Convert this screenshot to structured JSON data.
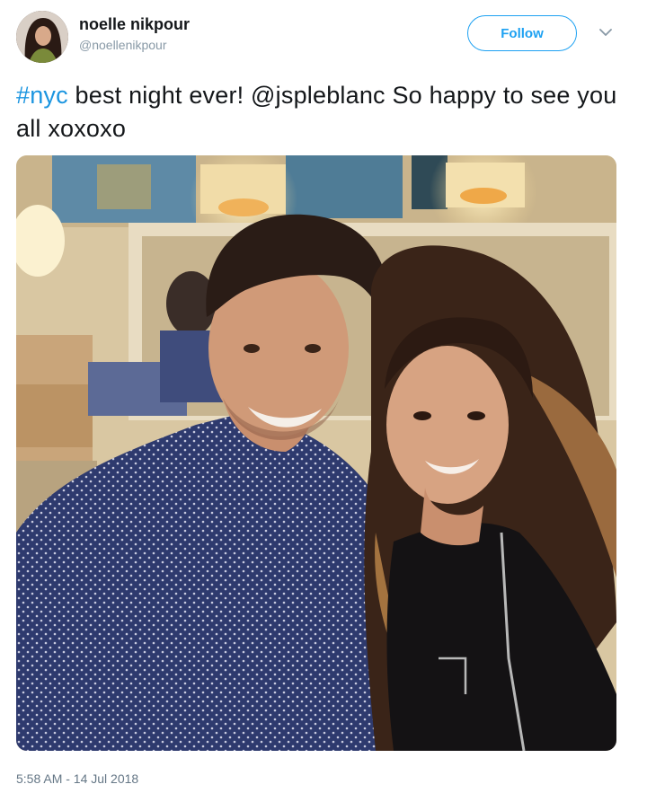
{
  "user": {
    "display_name": "noelle nikpour",
    "handle": "@noellenikpour"
  },
  "follow_label": "Follow",
  "tweet": {
    "hashtag": "#nyc",
    "text": " best night ever! @jspleblanc So happy to see you all xoxoxo",
    "timestamp": "5:58 AM - 14 Jul 2018"
  },
  "icons": {
    "caret": "chevron-down-icon"
  },
  "colors": {
    "accent": "#1da1f2",
    "hashtag": "#1b95e0",
    "text": "#14171a",
    "muted": "#8899a6"
  }
}
